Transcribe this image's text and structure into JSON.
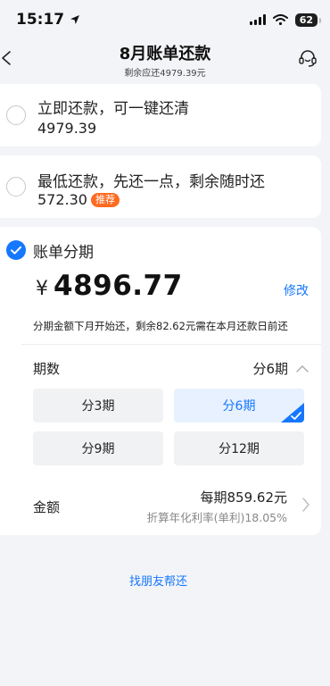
{
  "status_bar": {
    "time": "15:17",
    "battery": "62"
  },
  "nav": {
    "title": "8月账单还款",
    "subtitle": "剩余应还4979.39元"
  },
  "option_full": {
    "title": "立即还款，可一键还清",
    "amount": "4979.39"
  },
  "option_min": {
    "title": "最低还款，先还一点，剩余随时还",
    "amount": "572.30",
    "tag": "推荐"
  },
  "installment": {
    "title": "账单分期",
    "currency": "¥",
    "amount": "4896.77",
    "edit_label": "修改",
    "note": "分期金额下月开始还，剩余82.62元需在本月还款日前还",
    "period_label": "期数",
    "period_value": "分6期",
    "period_options": [
      "分3期",
      "分6期",
      "分9期",
      "分12期"
    ],
    "selected_period": "分6期",
    "amount_label": "金额",
    "per_period": "每期859.62元",
    "rate_text": "折算年化利率(单利)18.05%"
  },
  "friend_link": "找朋友帮还",
  "colors": {
    "accent": "#1677ff",
    "tag": "#ff6a21",
    "background": "#f3f4f7"
  }
}
